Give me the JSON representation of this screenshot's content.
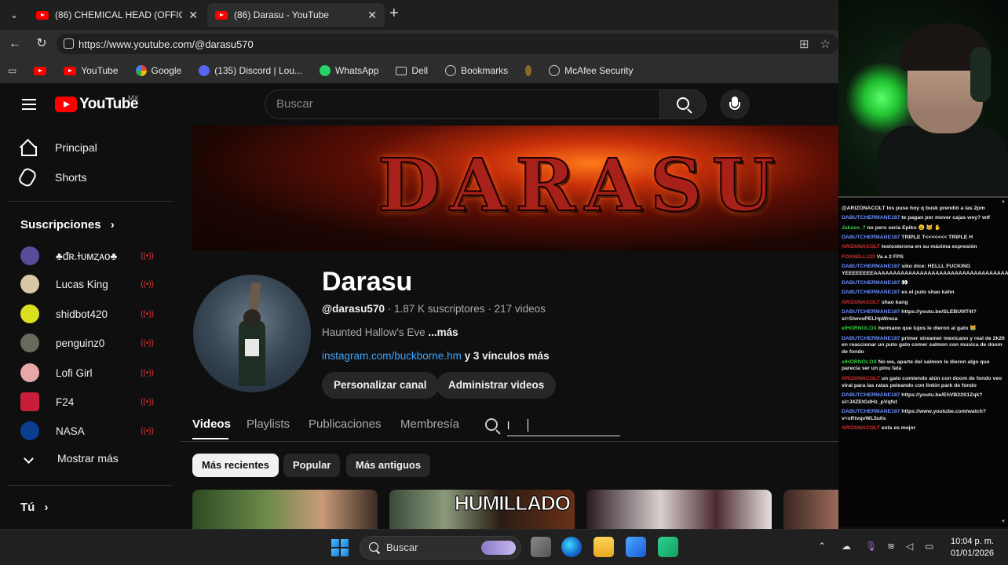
{
  "browser": {
    "tabs": [
      {
        "title": "(86) CHEMICAL HEAD (OFFICIAL M"
      },
      {
        "title": "(86) Darasu - YouTube"
      }
    ],
    "url": "https://www.youtube.com/@darasu570",
    "bookmarks": [
      {
        "label": "",
        "icon": "youtube-icon",
        "color": "#ff0000"
      },
      {
        "label": "YouTube",
        "icon": "youtube-icon",
        "color": "#ff0000"
      },
      {
        "label": "Google",
        "icon": "google-icon",
        "color": "#4285f4"
      },
      {
        "label": "(135) Discord | Lou...",
        "icon": "discord-icon",
        "color": "#5865f2"
      },
      {
        "label": "WhatsApp",
        "icon": "whatsapp-icon",
        "color": "#25d366"
      },
      {
        "label": "Dell",
        "icon": "folder-icon",
        "color": "#cccccc"
      },
      {
        "label": "Bookmarks",
        "icon": "globe-icon",
        "color": "#cccccc"
      },
      {
        "label": "",
        "icon": "extension-icon",
        "color": "#8a6a2a"
      },
      {
        "label": "McAfee Security",
        "icon": "globe-icon",
        "color": "#cccccc"
      }
    ]
  },
  "youtube": {
    "logo_text": "YouTube",
    "country_code": "MX",
    "search_placeholder": "Buscar",
    "nav": {
      "home": "Principal",
      "shorts": "Shorts",
      "subscriptions_heading": "Suscripciones",
      "show_more": "Mostrar más",
      "you": "Tú"
    },
    "subscriptions": [
      {
        "name": "♣ᵭʀ.ɫᴜᴍȥᴀᴏ♣",
        "color": "#5a4a9a",
        "live": true
      },
      {
        "name": "Lucas King",
        "color": "#d8c8a8",
        "live": true
      },
      {
        "name": "shidbot420",
        "color": "#d8e020",
        "live": true
      },
      {
        "name": "penguinz0",
        "color": "#6a6a5a",
        "live": true
      },
      {
        "name": "Lofi Girl",
        "color": "#e8a8a8",
        "live": true
      },
      {
        "name": "F24",
        "color": "#c81e3a",
        "live": true
      },
      {
        "name": "NASA",
        "color": "#0b3d91",
        "live": true
      }
    ],
    "banner_text": "DARASU",
    "channel": {
      "name": "Darasu",
      "handle": "@darasu570",
      "subscribers": "1.87 K suscriptores",
      "videos": "217 videos",
      "description": "Haunted Hallow's Eve",
      "description_more": "...más",
      "link": "instagram.com/buckborne.hm",
      "link_more": "y 3 vínculos más",
      "customize_button": "Personalizar canal",
      "manage_button": "Administrar videos"
    },
    "tabs": [
      "Videos",
      "Playlists",
      "Publicaciones",
      "Membresía"
    ],
    "active_tab": "Videos",
    "channel_search_value": "l",
    "chips": [
      "Más recientes",
      "Popular",
      "Más antiguos"
    ],
    "active_chip": "Más recientes",
    "thumbnail_overlay_text": "HUMILLADO"
  },
  "chat": [
    {
      "user": "",
      "user_color": "red",
      "text": "@ARIZONACOLT los puse hoy q busk prendió a las 2pm"
    },
    {
      "user": "DABUTCHERMANE187",
      "user_color": "blue",
      "text": "te pagan por mover cajas wey? wtf"
    },
    {
      "user": "Jakeeo_7",
      "user_color": "green",
      "text": "no pero sería Epiko 😮 😹 ✋"
    },
    {
      "user": "DABUTCHERMANE187",
      "user_color": "blue",
      "text": "TRIPLE T<<<<<<< TRIPLE H"
    },
    {
      "user": "ARIZONACOLT",
      "user_color": "red",
      "text": "testosterona en su máxima expresión"
    },
    {
      "user": "FOXXELL123",
      "user_color": "red",
      "text": "Va a 2 FPS"
    },
    {
      "user": "DABUTCHERMANE187",
      "user_color": "blue",
      "text": "siko dice: HELLL FUCKING YEEEEEEEEAAAAAAAAAAAAAAAAAAAAAAAAAAAAAAAAAAAAAAAAAAHHHHHHHHHHHHHHHHHHHHHHHHHHHHHHHHHH"
    },
    {
      "user": "DABUTCHERMANE187",
      "user_color": "blue",
      "text": "👀"
    },
    {
      "user": "DABUTCHERMANE187",
      "user_color": "blue",
      "text": "es el puto shao kahn"
    },
    {
      "user": "ARIZONACOLT",
      "user_color": "red",
      "text": "shao kang"
    },
    {
      "user": "DABUTCHERMANE187",
      "user_color": "blue",
      "text": "https://youtu.be/SLEBU0IT4I? si=SiwvoPELHpWreza"
    },
    {
      "user": "elHORNOLOX",
      "user_color": "green",
      "text": "hermano que lujos le dieron al gato 😹"
    },
    {
      "user": "DABUTCHERMANE187",
      "user_color": "blue",
      "text": "primer streamer mexicano y real de 2k26 en reaccionar un puto gato comer salmon con musica de doom de fondo"
    },
    {
      "user": "elHORNOLOX",
      "user_color": "green",
      "text": "No we, aparte del salmon le dieron algo que parecia ser un pinu fata"
    },
    {
      "user": "ARIZONACOLT",
      "user_color": "red",
      "text": "un gato comiendo atún con doom de fondo veo viral para las ratas peleando con linkin park de fondo"
    },
    {
      "user": "DABUTCHERMANE187",
      "user_color": "blue",
      "text": "https://youtu.be/EhVB22S1Zqk? si=J4ZEtGdHz_pVqfst"
    },
    {
      "user": "DABUTCHERMANE187",
      "user_color": "blue",
      "text": "https://www.youtube.com/watch? v=xRtvqvWL5u0s"
    },
    {
      "user": "ARIZONACOLT",
      "user_color": "red",
      "text": "esta es mejor"
    }
  ],
  "taskbar": {
    "search_placeholder": "Buscar",
    "time": "10:04 p. m.",
    "date": "01/01/2026"
  }
}
